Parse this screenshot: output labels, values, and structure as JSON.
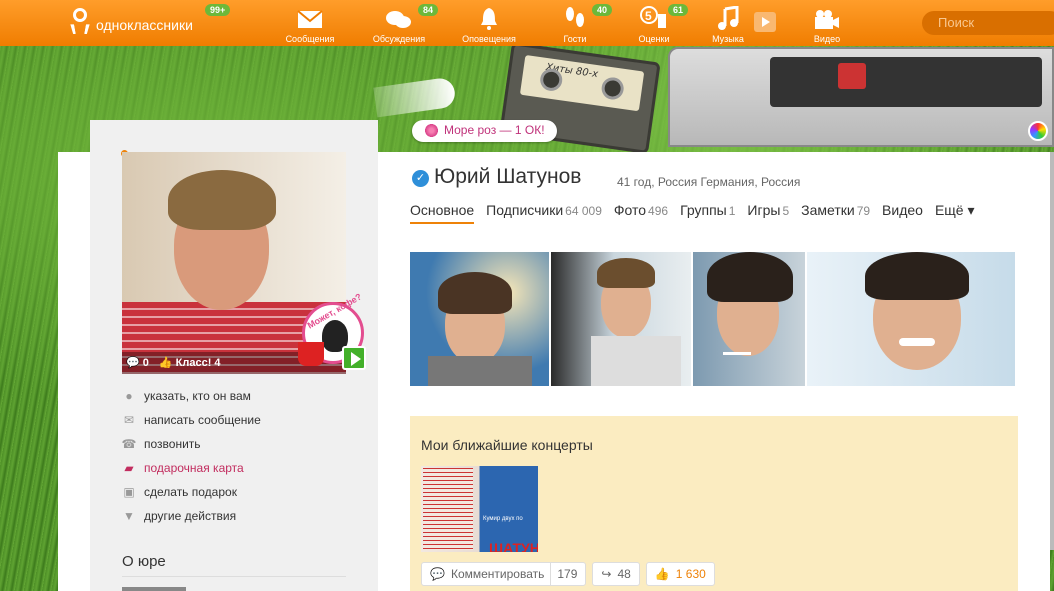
{
  "topbar": {
    "logo_text": "одноклассники",
    "logo_badge": "99+",
    "nav": [
      {
        "label": "Сообщения",
        "icon": "envelope-icon",
        "badge": ""
      },
      {
        "label": "Обсуждения",
        "icon": "chat-bubbles-icon",
        "badge": "84"
      },
      {
        "label": "Оповещения",
        "icon": "bell-icon",
        "badge": ""
      },
      {
        "label": "Гости",
        "icon": "footprints-icon",
        "badge": "40"
      },
      {
        "label": "Оценки",
        "icon": "rating-5-icon",
        "badge": "61"
      },
      {
        "label": "Музыка",
        "icon": "music-note-icon",
        "badge": ""
      },
      {
        "label": "Видео",
        "icon": "video-camera-icon",
        "badge": ""
      }
    ],
    "search_placeholder": "Поиск"
  },
  "promo": {
    "label": "Море роз — 1 ОК!"
  },
  "cassette_label": "Хиты 80-х",
  "profile": {
    "name": "Юрий Шатунов",
    "meta": "41 год, Россия Германия, Россия",
    "avatar_stats": {
      "comments": "0",
      "klass": "Класс! 4"
    },
    "sticker_text": "Может, кофе?",
    "tabs": [
      {
        "label": "Основное",
        "count": ""
      },
      {
        "label": "Подписчики",
        "count": "64 009"
      },
      {
        "label": "Фото",
        "count": "496"
      },
      {
        "label": "Группы",
        "count": "1"
      },
      {
        "label": "Игры",
        "count": "5"
      },
      {
        "label": "Заметки",
        "count": "79"
      },
      {
        "label": "Видео",
        "count": ""
      },
      {
        "label": "Ещё ▾",
        "count": ""
      }
    ]
  },
  "actions": [
    {
      "label": "указать, кто он вам",
      "icon": "person-pin-icon"
    },
    {
      "label": "написать сообщение",
      "icon": "envelope-icon"
    },
    {
      "label": "позвонить",
      "icon": "phone-icon"
    },
    {
      "label": "подарочная карта",
      "icon": "gift-card-icon"
    },
    {
      "label": "сделать подарок",
      "icon": "gift-icon"
    },
    {
      "label": "другие действия",
      "icon": "triangle-down-icon"
    }
  ],
  "about": {
    "title": "О юре"
  },
  "concerts": {
    "title": "Мои ближайшие концерты",
    "poster_caption": "Кумир двух по",
    "poster_big": "ШАТУН",
    "comment_label": "Комментировать",
    "comment_count": "179",
    "share_count": "48",
    "klass_count": "1 630"
  }
}
